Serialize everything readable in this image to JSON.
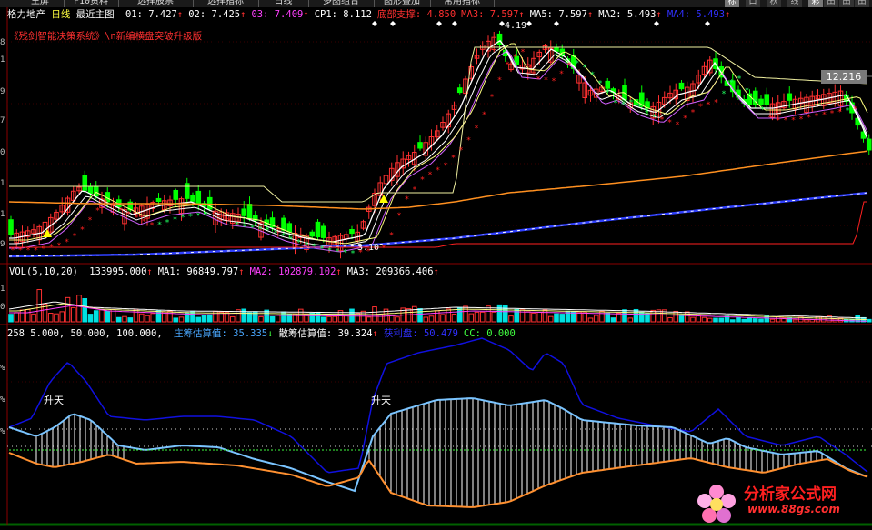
{
  "toolbar": {
    "tabs": [
      "主屏",
      "F10资料",
      "选择股票",
      "选择指标",
      "日线",
      "多图组合",
      "图形叠加",
      "常用指标"
    ],
    "icons": [
      "标",
      "口",
      "秋",
      "线",
      "彩",
      "田",
      "田",
      "田",
      "田"
    ]
  },
  "price_panel": {
    "stock_name": "格力地产",
    "period": "日线",
    "mode": "最近主图",
    "indicators": [
      {
        "label": "01: 7.427",
        "arrow": "↑",
        "color": "#ffffff"
      },
      {
        "label": "02: 7.425",
        "arrow": "↑",
        "color": "#ffffff"
      },
      {
        "label": "03: 7.409",
        "arrow": "↑",
        "color": "#ff40ff"
      },
      {
        "label": "CP1: 8.112",
        "arrow": "",
        "color": "#ffffff"
      },
      {
        "label": "底部支撑: 4.850",
        "arrow": "",
        "color": "#ff3030"
      },
      {
        "label": "MA3: 7.597",
        "arrow": "↑",
        "color": "#ff3030"
      },
      {
        "label": "MA5: 7.597",
        "arrow": "↑",
        "color": "#ffffff"
      },
      {
        "label": "MA2: 5.493",
        "arrow": "↑",
        "color": "#ffffff"
      },
      {
        "label": "MA4: 5.493",
        "arrow": "↑",
        "color": "#3030ff"
      }
    ],
    "subtitle": "《残剑智能决策系统》\\n新编横盘突破升级版",
    "price_labels": [
      "8",
      "1",
      "9",
      "7",
      "0",
      "1",
      "1",
      "9"
    ],
    "current_price": "12.216",
    "peak_label": "4.19",
    "low_label": "3.10"
  },
  "volume_panel": {
    "name": "VOL(5,10,20)",
    "indicators": [
      {
        "label": "133995.000",
        "arrow": "↑",
        "color": "#ffffff"
      },
      {
        "label": "MA1: 96849.797",
        "arrow": "↑",
        "color": "#ffffff"
      },
      {
        "label": "MA2: 102879.102",
        "arrow": "↑",
        "color": "#ff40ff"
      },
      {
        "label": "MA3: 209366.406",
        "arrow": "↑",
        "color": "#ffffff"
      }
    ],
    "price_labels": [
      "1",
      "0"
    ]
  },
  "indicator_panel": {
    "name": "258",
    "params": "5.000, 50.000, 100.000,",
    "indicators": [
      {
        "label": "庄筹估算值: 35.335",
        "arrow": "↓",
        "color": "#4aa8ff"
      },
      {
        "label": "散筹估算值: 39.324",
        "arrow": "↑",
        "color": "#ffffff"
      },
      {
        "label": "获利盘: 50.479",
        "arrow": "",
        "color": "#3030ff"
      },
      {
        "label": "CC: 0.000",
        "arrow": "",
        "color": "#40ff40"
      }
    ],
    "price_labels": [
      "%",
      "%",
      "%"
    ],
    "signals": [
      "升天",
      "升天"
    ]
  },
  "watermark": {
    "main": "分析家公式网",
    "url": "www.88gs.com"
  },
  "colors": {
    "up": "#ff3030",
    "down": "#00ff00",
    "ma_white": "#ffffff",
    "ma_yellow": "#ffff80",
    "ma_orange": "#ff9020",
    "ma_blue": "#3040ff",
    "support": "#ff2020",
    "cyan": "#00e0e0",
    "chip_blue": "#7ac4ff",
    "chip_orange": "#ff9030",
    "profit_blue": "#1010e0"
  }
}
